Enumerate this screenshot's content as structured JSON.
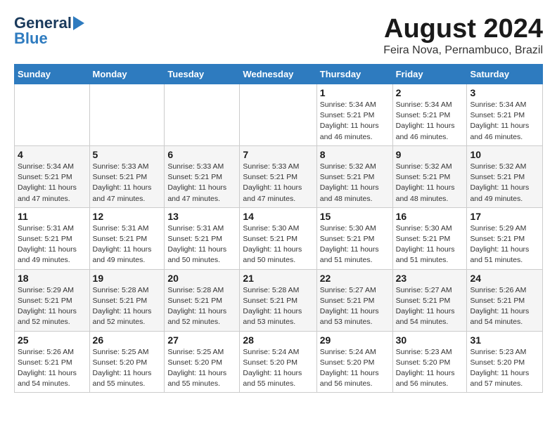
{
  "header": {
    "logo_line1": "General",
    "logo_line2": "Blue",
    "month_year": "August 2024",
    "location": "Feira Nova, Pernambuco, Brazil"
  },
  "weekdays": [
    "Sunday",
    "Monday",
    "Tuesday",
    "Wednesday",
    "Thursday",
    "Friday",
    "Saturday"
  ],
  "weeks": [
    [
      {
        "day": "",
        "info": ""
      },
      {
        "day": "",
        "info": ""
      },
      {
        "day": "",
        "info": ""
      },
      {
        "day": "",
        "info": ""
      },
      {
        "day": "1",
        "info": "Sunrise: 5:34 AM\nSunset: 5:21 PM\nDaylight: 11 hours\nand 46 minutes."
      },
      {
        "day": "2",
        "info": "Sunrise: 5:34 AM\nSunset: 5:21 PM\nDaylight: 11 hours\nand 46 minutes."
      },
      {
        "day": "3",
        "info": "Sunrise: 5:34 AM\nSunset: 5:21 PM\nDaylight: 11 hours\nand 46 minutes."
      }
    ],
    [
      {
        "day": "4",
        "info": "Sunrise: 5:34 AM\nSunset: 5:21 PM\nDaylight: 11 hours\nand 47 minutes."
      },
      {
        "day": "5",
        "info": "Sunrise: 5:33 AM\nSunset: 5:21 PM\nDaylight: 11 hours\nand 47 minutes."
      },
      {
        "day": "6",
        "info": "Sunrise: 5:33 AM\nSunset: 5:21 PM\nDaylight: 11 hours\nand 47 minutes."
      },
      {
        "day": "7",
        "info": "Sunrise: 5:33 AM\nSunset: 5:21 PM\nDaylight: 11 hours\nand 47 minutes."
      },
      {
        "day": "8",
        "info": "Sunrise: 5:32 AM\nSunset: 5:21 PM\nDaylight: 11 hours\nand 48 minutes."
      },
      {
        "day": "9",
        "info": "Sunrise: 5:32 AM\nSunset: 5:21 PM\nDaylight: 11 hours\nand 48 minutes."
      },
      {
        "day": "10",
        "info": "Sunrise: 5:32 AM\nSunset: 5:21 PM\nDaylight: 11 hours\nand 49 minutes."
      }
    ],
    [
      {
        "day": "11",
        "info": "Sunrise: 5:31 AM\nSunset: 5:21 PM\nDaylight: 11 hours\nand 49 minutes."
      },
      {
        "day": "12",
        "info": "Sunrise: 5:31 AM\nSunset: 5:21 PM\nDaylight: 11 hours\nand 49 minutes."
      },
      {
        "day": "13",
        "info": "Sunrise: 5:31 AM\nSunset: 5:21 PM\nDaylight: 11 hours\nand 50 minutes."
      },
      {
        "day": "14",
        "info": "Sunrise: 5:30 AM\nSunset: 5:21 PM\nDaylight: 11 hours\nand 50 minutes."
      },
      {
        "day": "15",
        "info": "Sunrise: 5:30 AM\nSunset: 5:21 PM\nDaylight: 11 hours\nand 51 minutes."
      },
      {
        "day": "16",
        "info": "Sunrise: 5:30 AM\nSunset: 5:21 PM\nDaylight: 11 hours\nand 51 minutes."
      },
      {
        "day": "17",
        "info": "Sunrise: 5:29 AM\nSunset: 5:21 PM\nDaylight: 11 hours\nand 51 minutes."
      }
    ],
    [
      {
        "day": "18",
        "info": "Sunrise: 5:29 AM\nSunset: 5:21 PM\nDaylight: 11 hours\nand 52 minutes."
      },
      {
        "day": "19",
        "info": "Sunrise: 5:28 AM\nSunset: 5:21 PM\nDaylight: 11 hours\nand 52 minutes."
      },
      {
        "day": "20",
        "info": "Sunrise: 5:28 AM\nSunset: 5:21 PM\nDaylight: 11 hours\nand 52 minutes."
      },
      {
        "day": "21",
        "info": "Sunrise: 5:28 AM\nSunset: 5:21 PM\nDaylight: 11 hours\nand 53 minutes."
      },
      {
        "day": "22",
        "info": "Sunrise: 5:27 AM\nSunset: 5:21 PM\nDaylight: 11 hours\nand 53 minutes."
      },
      {
        "day": "23",
        "info": "Sunrise: 5:27 AM\nSunset: 5:21 PM\nDaylight: 11 hours\nand 54 minutes."
      },
      {
        "day": "24",
        "info": "Sunrise: 5:26 AM\nSunset: 5:21 PM\nDaylight: 11 hours\nand 54 minutes."
      }
    ],
    [
      {
        "day": "25",
        "info": "Sunrise: 5:26 AM\nSunset: 5:21 PM\nDaylight: 11 hours\nand 54 minutes."
      },
      {
        "day": "26",
        "info": "Sunrise: 5:25 AM\nSunset: 5:20 PM\nDaylight: 11 hours\nand 55 minutes."
      },
      {
        "day": "27",
        "info": "Sunrise: 5:25 AM\nSunset: 5:20 PM\nDaylight: 11 hours\nand 55 minutes."
      },
      {
        "day": "28",
        "info": "Sunrise: 5:24 AM\nSunset: 5:20 PM\nDaylight: 11 hours\nand 55 minutes."
      },
      {
        "day": "29",
        "info": "Sunrise: 5:24 AM\nSunset: 5:20 PM\nDaylight: 11 hours\nand 56 minutes."
      },
      {
        "day": "30",
        "info": "Sunrise: 5:23 AM\nSunset: 5:20 PM\nDaylight: 11 hours\nand 56 minutes."
      },
      {
        "day": "31",
        "info": "Sunrise: 5:23 AM\nSunset: 5:20 PM\nDaylight: 11 hours\nand 57 minutes."
      }
    ]
  ]
}
